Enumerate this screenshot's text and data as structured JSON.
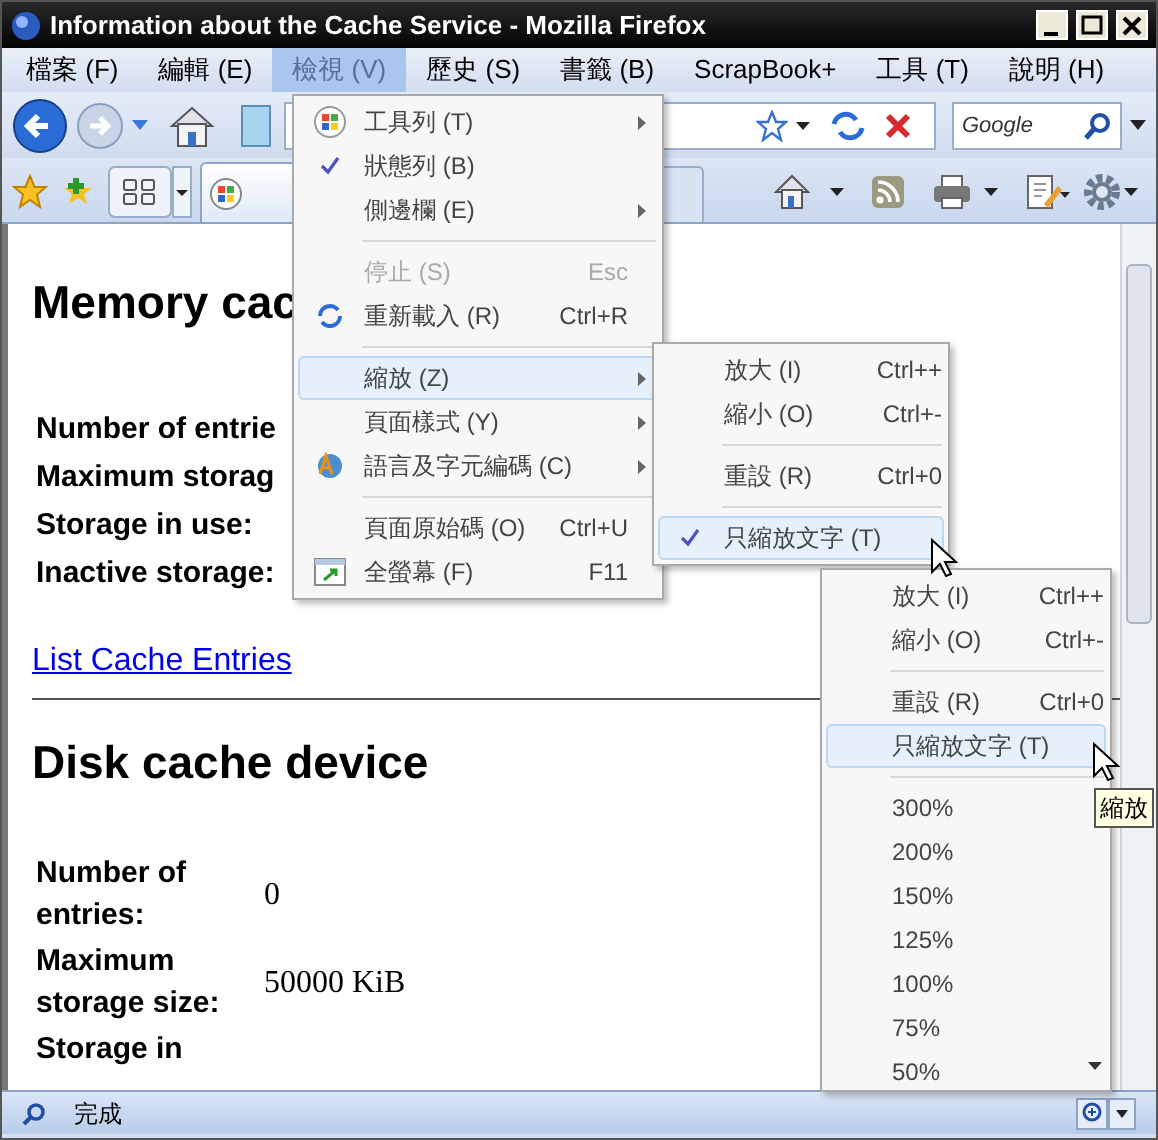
{
  "window": {
    "title": "Information about the Cache Service - Mozilla Firefox"
  },
  "menubar": [
    {
      "label": "檔案 (F)",
      "selected": false
    },
    {
      "label": "編輯 (E)",
      "selected": false
    },
    {
      "label": "檢視 (V)",
      "selected": true
    },
    {
      "label": "歷史 (S)",
      "selected": false
    },
    {
      "label": "書籤 (B)",
      "selected": false
    },
    {
      "label": "ScrapBook+",
      "selected": false
    },
    {
      "label": "工具 (T)",
      "selected": false
    },
    {
      "label": "說明 (H)",
      "selected": false
    }
  ],
  "search": {
    "placeholder": "Google"
  },
  "tabs": [
    {
      "selected": true
    }
  ],
  "page": {
    "sections": [
      {
        "heading": "Memory cac",
        "rows": [
          {
            "label": "Number of entrie"
          },
          {
            "label": "Maximum storag"
          },
          {
            "label": "Storage in use:"
          },
          {
            "label": "Inactive storage:"
          }
        ],
        "link": "List Cache Entries"
      },
      {
        "heading": "Disk cache device",
        "rows": [
          {
            "label": "Number of entries:",
            "value": "0"
          },
          {
            "label": "Maximum storage size:",
            "value": "50000 KiB"
          },
          {
            "label": "Storage in"
          }
        ]
      }
    ]
  },
  "view_menu": [
    {
      "kind": "item",
      "label": "工具列 (T)",
      "submenu": true,
      "checked": false,
      "disabled": false,
      "selected": false
    },
    {
      "kind": "item",
      "label": "狀態列 (B)",
      "submenu": false,
      "checked": true,
      "disabled": false,
      "selected": false
    },
    {
      "kind": "item",
      "label": "側邊欄 (E)",
      "submenu": true,
      "checked": false,
      "disabled": false,
      "selected": false
    },
    {
      "kind": "separator"
    },
    {
      "kind": "item",
      "label": "停止 (S)",
      "shortcut": "Esc",
      "submenu": false,
      "checked": false,
      "disabled": true,
      "selected": false
    },
    {
      "kind": "item",
      "label": "重新載入 (R)",
      "shortcut": "Ctrl+R",
      "submenu": false,
      "checked": false,
      "disabled": false,
      "selected": false
    },
    {
      "kind": "separator"
    },
    {
      "kind": "item",
      "label": "縮放 (Z)",
      "submenu": true,
      "checked": false,
      "disabled": false,
      "selected": true
    },
    {
      "kind": "item",
      "label": "頁面樣式 (Y)",
      "submenu": true,
      "checked": false,
      "disabled": false,
      "selected": false
    },
    {
      "kind": "item",
      "label": "語言及字元編碼 (C)",
      "submenu": true,
      "checked": false,
      "disabled": false,
      "selected": false
    },
    {
      "kind": "separator"
    },
    {
      "kind": "item",
      "label": "頁面原始碼 (O)",
      "shortcut": "Ctrl+U",
      "submenu": false,
      "checked": false,
      "disabled": false,
      "selected": false
    },
    {
      "kind": "item",
      "label": "全螢幕 (F)",
      "shortcut": "F11",
      "submenu": false,
      "checked": false,
      "disabled": false,
      "selected": false
    }
  ],
  "zoom_submenu": [
    {
      "kind": "item",
      "label": "放大 (I)",
      "shortcut": "Ctrl++",
      "checked": false,
      "selected": false
    },
    {
      "kind": "item",
      "label": "縮小 (O)",
      "shortcut": "Ctrl+-",
      "checked": false,
      "selected": false
    },
    {
      "kind": "separator"
    },
    {
      "kind": "item",
      "label": "重設 (R)",
      "shortcut": "Ctrl+0",
      "checked": false,
      "selected": false
    },
    {
      "kind": "separator"
    },
    {
      "kind": "item",
      "label": "只縮放文字 (T)",
      "checked": true,
      "selected": true
    }
  ],
  "zoom_dropdown": [
    {
      "kind": "item",
      "label": "放大 (I)",
      "shortcut": "Ctrl++",
      "selected": false
    },
    {
      "kind": "item",
      "label": "縮小 (O)",
      "shortcut": "Ctrl+-",
      "selected": false
    },
    {
      "kind": "separator"
    },
    {
      "kind": "item",
      "label": "重設 (R)",
      "shortcut": "Ctrl+0",
      "selected": false
    },
    {
      "kind": "item",
      "label": "只縮放文字 (T)",
      "selected": true
    },
    {
      "kind": "separator"
    },
    {
      "kind": "item",
      "label": "300%",
      "selected": false
    },
    {
      "kind": "item",
      "label": "200%",
      "selected": false
    },
    {
      "kind": "item",
      "label": "150%",
      "selected": false
    },
    {
      "kind": "item",
      "label": "125%",
      "selected": false
    },
    {
      "kind": "item",
      "label": "100%",
      "selected": false
    },
    {
      "kind": "item",
      "label": "75%",
      "selected": false
    },
    {
      "kind": "item",
      "label": "50%",
      "selected": false
    }
  ],
  "tooltip": "縮放",
  "status_bar": {
    "text": "完成"
  }
}
